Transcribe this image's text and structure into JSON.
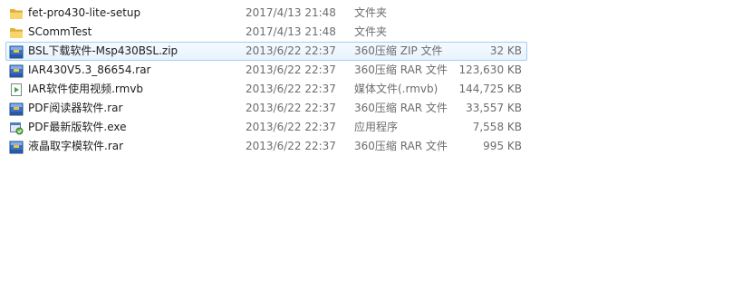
{
  "files": [
    {
      "name": "fet-pro430-lite-setup",
      "modified": "2017/4/13 21:48",
      "type": "文件夹",
      "size": "",
      "icon": "folder-icon",
      "selected": false
    },
    {
      "name": "SCommTest",
      "modified": "2017/4/13 21:48",
      "type": "文件夹",
      "size": "",
      "icon": "folder-icon",
      "selected": false
    },
    {
      "name": "BSL下载软件-Msp430BSL.zip",
      "modified": "2013/6/22 22:37",
      "type": "360压缩 ZIP 文件",
      "size": "32 KB",
      "icon": "archive-icon",
      "selected": true
    },
    {
      "name": "IAR430V5.3_86654.rar",
      "modified": "2013/6/22 22:37",
      "type": "360压缩 RAR 文件",
      "size": "123,630 KB",
      "icon": "archive-icon",
      "selected": false
    },
    {
      "name": "IAR软件使用视频.rmvb",
      "modified": "2013/6/22 22:37",
      "type": "媒体文件(.rmvb)",
      "size": "144,725 KB",
      "icon": "media-icon",
      "selected": false
    },
    {
      "name": "PDF阅读器软件.rar",
      "modified": "2013/6/22 22:37",
      "type": "360压缩 RAR 文件",
      "size": "33,557 KB",
      "icon": "archive-icon",
      "selected": false
    },
    {
      "name": "PDF最新版软件.exe",
      "modified": "2013/6/22 22:37",
      "type": "应用程序",
      "size": "7,558 KB",
      "icon": "installer-icon",
      "selected": false
    },
    {
      "name": "液晶取字模软件.rar",
      "modified": "2013/6/22 22:37",
      "type": "360压缩 RAR 文件",
      "size": "995 KB",
      "icon": "archive-icon",
      "selected": false
    }
  ],
  "colors": {
    "selection_border": "#a5cdf2",
    "selection_fill": "#e8f3fe",
    "secondary_text": "#6d6d6d"
  }
}
